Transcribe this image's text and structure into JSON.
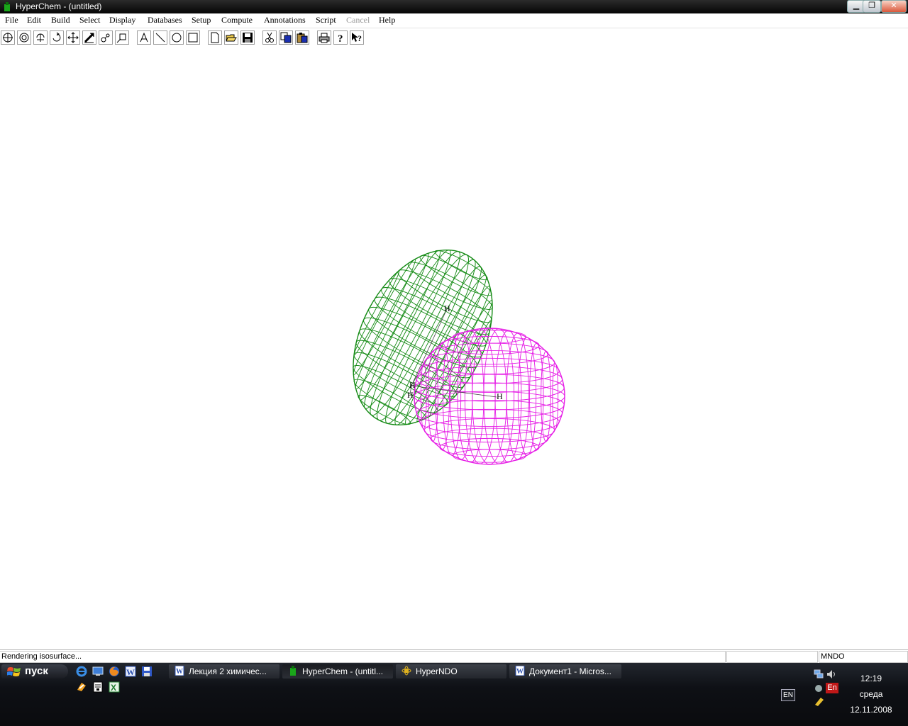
{
  "window": {
    "title": "HyperChem - (untitled)"
  },
  "menu": [
    {
      "label": "File",
      "enabled": true
    },
    {
      "label": "Edit",
      "enabled": true
    },
    {
      "label": "Build",
      "enabled": true
    },
    {
      "label": "Select",
      "enabled": true
    },
    {
      "label": "Display",
      "enabled": true
    },
    {
      "label": "Databases",
      "enabled": true
    },
    {
      "label": "Setup",
      "enabled": true
    },
    {
      "label": "Compute",
      "enabled": true
    },
    {
      "label": "Annotations",
      "enabled": true
    },
    {
      "label": "Script",
      "enabled": true
    },
    {
      "label": "Cancel",
      "enabled": false
    },
    {
      "label": "Help",
      "enabled": true
    }
  ],
  "toolbar": {
    "tools": [
      "draw-tool-icon",
      "select-tool-icon",
      "rotate-out-of-plane-icon",
      "rotate-in-plane-icon",
      "translate-icon",
      "z-translate-icon",
      "zoom-icon",
      "z-clip-icon",
      "text-annotation-icon",
      "line-annotation-icon",
      "ellipse-annotation-icon",
      "rectangle-annotation-icon",
      "new-file-icon",
      "open-file-icon",
      "save-file-icon",
      "cut-icon",
      "copy-icon",
      "paste-icon",
      "print-icon",
      "help-icon",
      "context-help-icon"
    ]
  },
  "molecule": {
    "atom_labels": [
      "H",
      "H",
      "H",
      "H"
    ],
    "isosurface": {
      "positive_color": "#138a13",
      "negative_color": "#e61ee6",
      "style": "wireframe"
    }
  },
  "status": {
    "message": "Rendering isosurface...",
    "middle": "",
    "method": "MNDO"
  },
  "taskbar": {
    "start_label": "пуск",
    "quick_launch": [
      "ie-icon",
      "desktop-icon",
      "firefox-icon",
      "word-icon",
      "save-icon",
      "winamp-icon",
      "notepad-icon",
      "excel-icon"
    ],
    "tasks": [
      {
        "label": "Лекция 2 химичес...",
        "icon": "word-doc-icon",
        "active": false
      },
      {
        "label": "HyperChem - (untitl...",
        "icon": "hyperchem-icon",
        "active": true
      },
      {
        "label": "HyperNDO",
        "icon": "hyperndo-icon",
        "active": false
      },
      {
        "label": "Документ1 - Micros...",
        "icon": "word-doc-icon",
        "active": false
      }
    ],
    "language": "EN",
    "tray_lang": "En",
    "time": "12:19",
    "day": "среда",
    "date": "12.11.2008"
  }
}
